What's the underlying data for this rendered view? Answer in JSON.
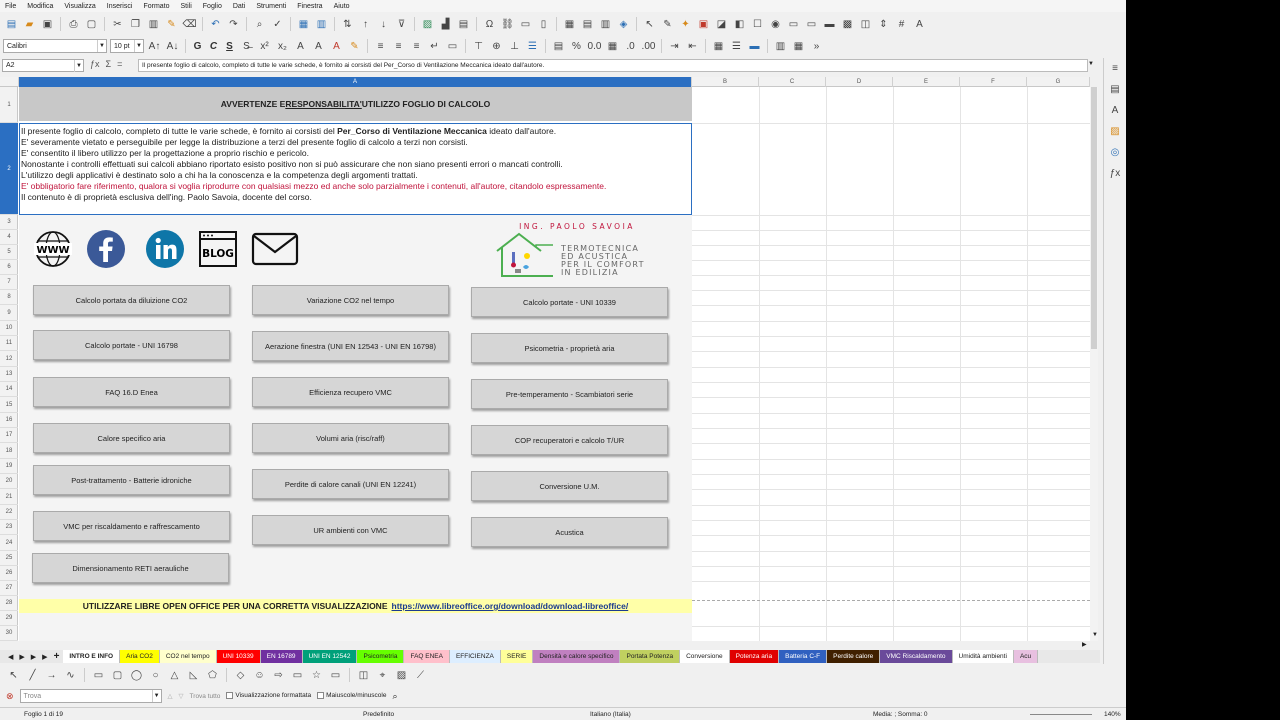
{
  "menu": [
    "File",
    "Modifica",
    "Visualizza",
    "Inserisci",
    "Formato",
    "Stili",
    "Foglio",
    "Dati",
    "Strumenti",
    "Finestra",
    "Aiuto"
  ],
  "font_name": "Calibri",
  "font_size": "10 pt",
  "name_box": "A2",
  "formula": "Il presente foglio di calcolo, completo di tutte le varie schede, è fornito ai corsisti del Per_Corso di Ventilazione Meccanica ideato dall'autore.",
  "columns": [
    "A",
    "B",
    "C",
    "D",
    "E",
    "F",
    "G"
  ],
  "rows": [
    "1",
    "2",
    "3",
    "4",
    "5",
    "6",
    "7",
    "8",
    "9",
    "10",
    "11",
    "12",
    "13",
    "14",
    "15",
    "16",
    "17",
    "18",
    "19",
    "20",
    "21",
    "22",
    "23",
    "24",
    "25",
    "26",
    "27",
    "28",
    "29",
    "30"
  ],
  "header_title": {
    "part1": "AVVERTENZE E ",
    "part2": "RESPONSABILITA'",
    "part3": " UTILIZZO FOGLIO DI CALCOLO"
  },
  "notice": {
    "l1_a": "Il presente foglio di calcolo, completo di tutte le varie schede, è fornito ai corsisti del ",
    "l1_b": "Per_Corso di Ventilazione Meccanica",
    "l1_c": " ideato dall'autore.",
    "l2": "E' severamente vietato e perseguibile per legge la distribuzione a terzi del presente foglio di calcolo a terzi non corsisti.",
    "l3": "E' consentito il libero utilizzo per la progettazione a proprio rischio e pericolo.",
    "l4": "Nonostante i controlli effettuati sui calcoli abbiano riportato esisto positivo non si può assicurare che non siano presenti errori o mancati controlli.",
    "l5": "L'utilizzo degli applicativi è destinato solo a chi ha la conoscenza e la competenza degli argomenti trattati.",
    "l6": "E' obbligatorio fare riferimento, qualora si voglia riprodurre con qualsiasi mezzo ed anche solo parzialmente i contenuti, all'autore, citandolo espressamente.",
    "l7": "Il contenuto è di proprietà esclusiva dell'ing. Paolo Savoia, docente del corso."
  },
  "social": {
    "www_label": "WWW",
    "blog_label": "BLOG"
  },
  "logo": {
    "name": "ING. PAOLO SAVOIA",
    "line1": "TERMOTECNICA",
    "line2": "ED ACUSTICA",
    "line3": "PER IL COMFORT",
    "line4": "IN EDILIZIA"
  },
  "buttons": [
    [
      "Calcolo portata da diluizione CO2",
      "Variazione CO2 nel tempo",
      "Calcolo portate - UNI 10339"
    ],
    [
      "Calcolo portate - UNI 16798",
      "Aerazione finestra (UNI EN 12543 - UNI EN 16798)",
      "Psicometria - proprietà aria"
    ],
    [
      "FAQ 16.D Enea",
      "Efficienza recupero VMC",
      "Pre-temperamento - Scambiatori serie"
    ],
    [
      "Calore specifico aria",
      "Volumi aria (risc/raff)",
      "COP recuperatori e calcolo T/UR"
    ],
    [
      "Post-trattamento - Batterie idroniche",
      "Perdite di calore canali (UNI EN 12241)",
      "Conversione U.M."
    ],
    [
      "VMC per riscaldamento e raffrescamento",
      "UR ambienti con VMC",
      "Acustica"
    ],
    [
      "Dimensionamento RETI aerauliche"
    ]
  ],
  "footer_row": {
    "text": "UTILIZZARE LIBRE OPEN OFFICE PER UNA CORRETTA VISUALIZZAZIONE",
    "link": "https://www.libreoffice.org/download/download-libreoffice/"
  },
  "sheet_tabs": [
    {
      "label": "INTRO E INFO",
      "color": "#ffffff",
      "active": true
    },
    {
      "label": "Aria CO2",
      "color": "#ffff00"
    },
    {
      "label": "CO2 nel tempo",
      "color": "#ffffcc"
    },
    {
      "label": "UNI 10339",
      "color": "#ff0000"
    },
    {
      "label": "EN 16789",
      "color": "#7030a0"
    },
    {
      "label": "UNI EN 12542",
      "color": "#00a07a"
    },
    {
      "label": "Psicometria",
      "color": "#66ff00"
    },
    {
      "label": "FAQ ENEA",
      "color": "#ffc0cb"
    },
    {
      "label": "EFFICIENZA",
      "color": "#ddeeff"
    },
    {
      "label": "SERIE",
      "color": "#ffff99"
    },
    {
      "label": "Densità e calore specifico",
      "color": "#c080c0"
    },
    {
      "label": "Portata Potenza",
      "color": "#c0d060"
    },
    {
      "label": "Conversione",
      "color": "#ffffff"
    },
    {
      "label": "Potenza aria",
      "color": "#e00000"
    },
    {
      "label": "Batteria C-F",
      "color": "#3060c0"
    },
    {
      "label": "Perdite calore",
      "color": "#402000"
    },
    {
      "label": "VMC Riscaldamento",
      "color": "#6a4a9a"
    },
    {
      "label": "Umidità ambienti",
      "color": "#ffffff"
    },
    {
      "label": "Acu",
      "color": "#e8c0e0"
    }
  ],
  "findbar": {
    "placeholder": "Trova",
    "find_all": "Trova tutto",
    "formatted": "Visualizzazione formattata",
    "match_case": "Maiuscole/minuscole"
  },
  "status": {
    "sheet": "Foglio 1 di 19",
    "style": "Predefinito",
    "language": "Italiano (Italia)",
    "sum": "Media: ; Somma: 0",
    "zoom": "140%"
  }
}
